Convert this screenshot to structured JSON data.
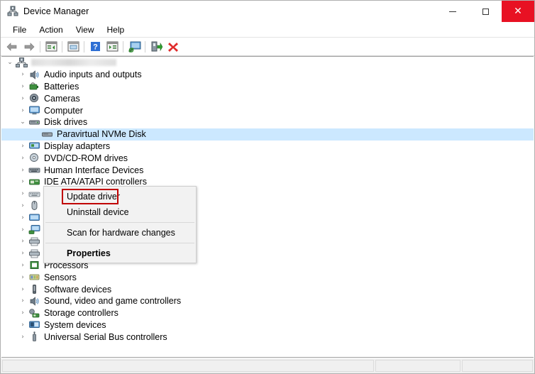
{
  "window": {
    "title": "Device Manager",
    "title_icon": "device-manager-icon",
    "controls": {
      "minimize": "minimize-button",
      "maximize": "maximize-button",
      "close": "close-button",
      "close_glyph": "✕",
      "close_color": "#e81123"
    }
  },
  "menubar": {
    "items": [
      {
        "label": "File"
      },
      {
        "label": "Action"
      },
      {
        "label": "View"
      },
      {
        "label": "Help"
      }
    ]
  },
  "toolbar": {
    "buttons": [
      {
        "name": "back-button",
        "icon": "arrow-left-icon"
      },
      {
        "name": "forward-button",
        "icon": "arrow-right-icon"
      },
      {
        "name": "separator-1",
        "icon": "separator"
      },
      {
        "name": "show-hide-console-tree-button",
        "icon": "console-tree-icon"
      },
      {
        "name": "separator-2",
        "icon": "separator"
      },
      {
        "name": "properties-button",
        "icon": "properties-window-icon"
      },
      {
        "name": "separator-3",
        "icon": "separator"
      },
      {
        "name": "help-button",
        "icon": "question-mark-icon"
      },
      {
        "name": "show-hide-action-pane-button",
        "icon": "action-pane-icon"
      },
      {
        "name": "separator-4",
        "icon": "separator"
      },
      {
        "name": "scan-for-hardware-changes-button",
        "icon": "scan-hardware-icon"
      },
      {
        "name": "separator-5",
        "icon": "separator"
      },
      {
        "name": "update-driver-button",
        "icon": "update-driver-icon"
      },
      {
        "name": "uninstall-device-button",
        "icon": "red-x-icon"
      }
    ]
  },
  "tree": {
    "root": {
      "label": "",
      "redacted": true,
      "icon": "computer-root-icon",
      "expanded": true
    },
    "items": [
      {
        "label": "Audio inputs and outputs",
        "icon": "speaker-icon",
        "expanded": false,
        "hidden": false
      },
      {
        "label": "Batteries",
        "icon": "battery-icon",
        "expanded": false,
        "hidden": false
      },
      {
        "label": "Cameras",
        "icon": "camera-icon",
        "expanded": false,
        "hidden": false
      },
      {
        "label": "Computer",
        "icon": "computer-icon",
        "expanded": false,
        "hidden": false
      },
      {
        "label": "Disk drives",
        "icon": "disk-drive-icon",
        "expanded": true,
        "hidden": false
      },
      {
        "label": "Paravirtual NVMe Disk",
        "icon": "disk-icon",
        "selected": true,
        "child": true,
        "obscured": true
      },
      {
        "label": "Display adapters",
        "icon": "display-adapter-icon",
        "expanded": false,
        "obscured": true
      },
      {
        "label": "DVD/CD-ROM drives",
        "icon": "dvd-drive-icon",
        "expanded": false,
        "obscured": true
      },
      {
        "label": "Human Interface Devices",
        "icon": "hid-icon",
        "expanded": false,
        "obscured": true
      },
      {
        "label": "IDE ATA/ATAPI controllers",
        "icon": "ide-controller-icon",
        "expanded": false,
        "obscured": true
      },
      {
        "label": "Keyboards",
        "icon": "keyboard-icon",
        "expanded": false,
        "obscured": true
      },
      {
        "label": "Mice and other pointing devices",
        "icon": "mouse-icon",
        "expanded": false,
        "obscured": false
      },
      {
        "label": "Monitors",
        "icon": "monitor-icon",
        "expanded": false,
        "hidden": false
      },
      {
        "label": "Network adapters",
        "icon": "network-adapter-icon",
        "expanded": false,
        "hidden": false
      },
      {
        "label": "Print queues",
        "icon": "print-queue-icon",
        "expanded": false,
        "hidden": false
      },
      {
        "label": "Printers",
        "icon": "printer-icon",
        "expanded": false,
        "hidden": false
      },
      {
        "label": "Processors",
        "icon": "processor-icon",
        "expanded": false,
        "hidden": false
      },
      {
        "label": "Sensors",
        "icon": "sensor-icon",
        "expanded": false,
        "hidden": false
      },
      {
        "label": "Software devices",
        "icon": "software-device-icon",
        "expanded": false,
        "hidden": false
      },
      {
        "label": "Sound, video and game controllers",
        "icon": "sound-controller-icon",
        "expanded": false,
        "hidden": false
      },
      {
        "label": "Storage controllers",
        "icon": "storage-controller-icon",
        "expanded": false,
        "hidden": false
      },
      {
        "label": "System devices",
        "icon": "system-device-icon",
        "expanded": false,
        "hidden": false
      },
      {
        "label": "Universal Serial Bus controllers",
        "icon": "usb-controller-icon",
        "expanded": false,
        "hidden": false
      }
    ],
    "chevron_collapsed": "›",
    "chevron_expanded": "⌄"
  },
  "context_menu": {
    "items": [
      {
        "label": "Update driver",
        "bold": false,
        "highlighted": true
      },
      {
        "label": "Uninstall device",
        "bold": false,
        "highlighted": false
      },
      {
        "separator": true
      },
      {
        "label": "Scan for hardware changes",
        "bold": false,
        "highlighted": false
      },
      {
        "separator": true
      },
      {
        "label": "Properties",
        "bold": true,
        "highlighted": false
      }
    ],
    "highlight_color": "#c00000"
  },
  "statusbar": {
    "panel1": "",
    "panel2": "",
    "panel3": ""
  }
}
